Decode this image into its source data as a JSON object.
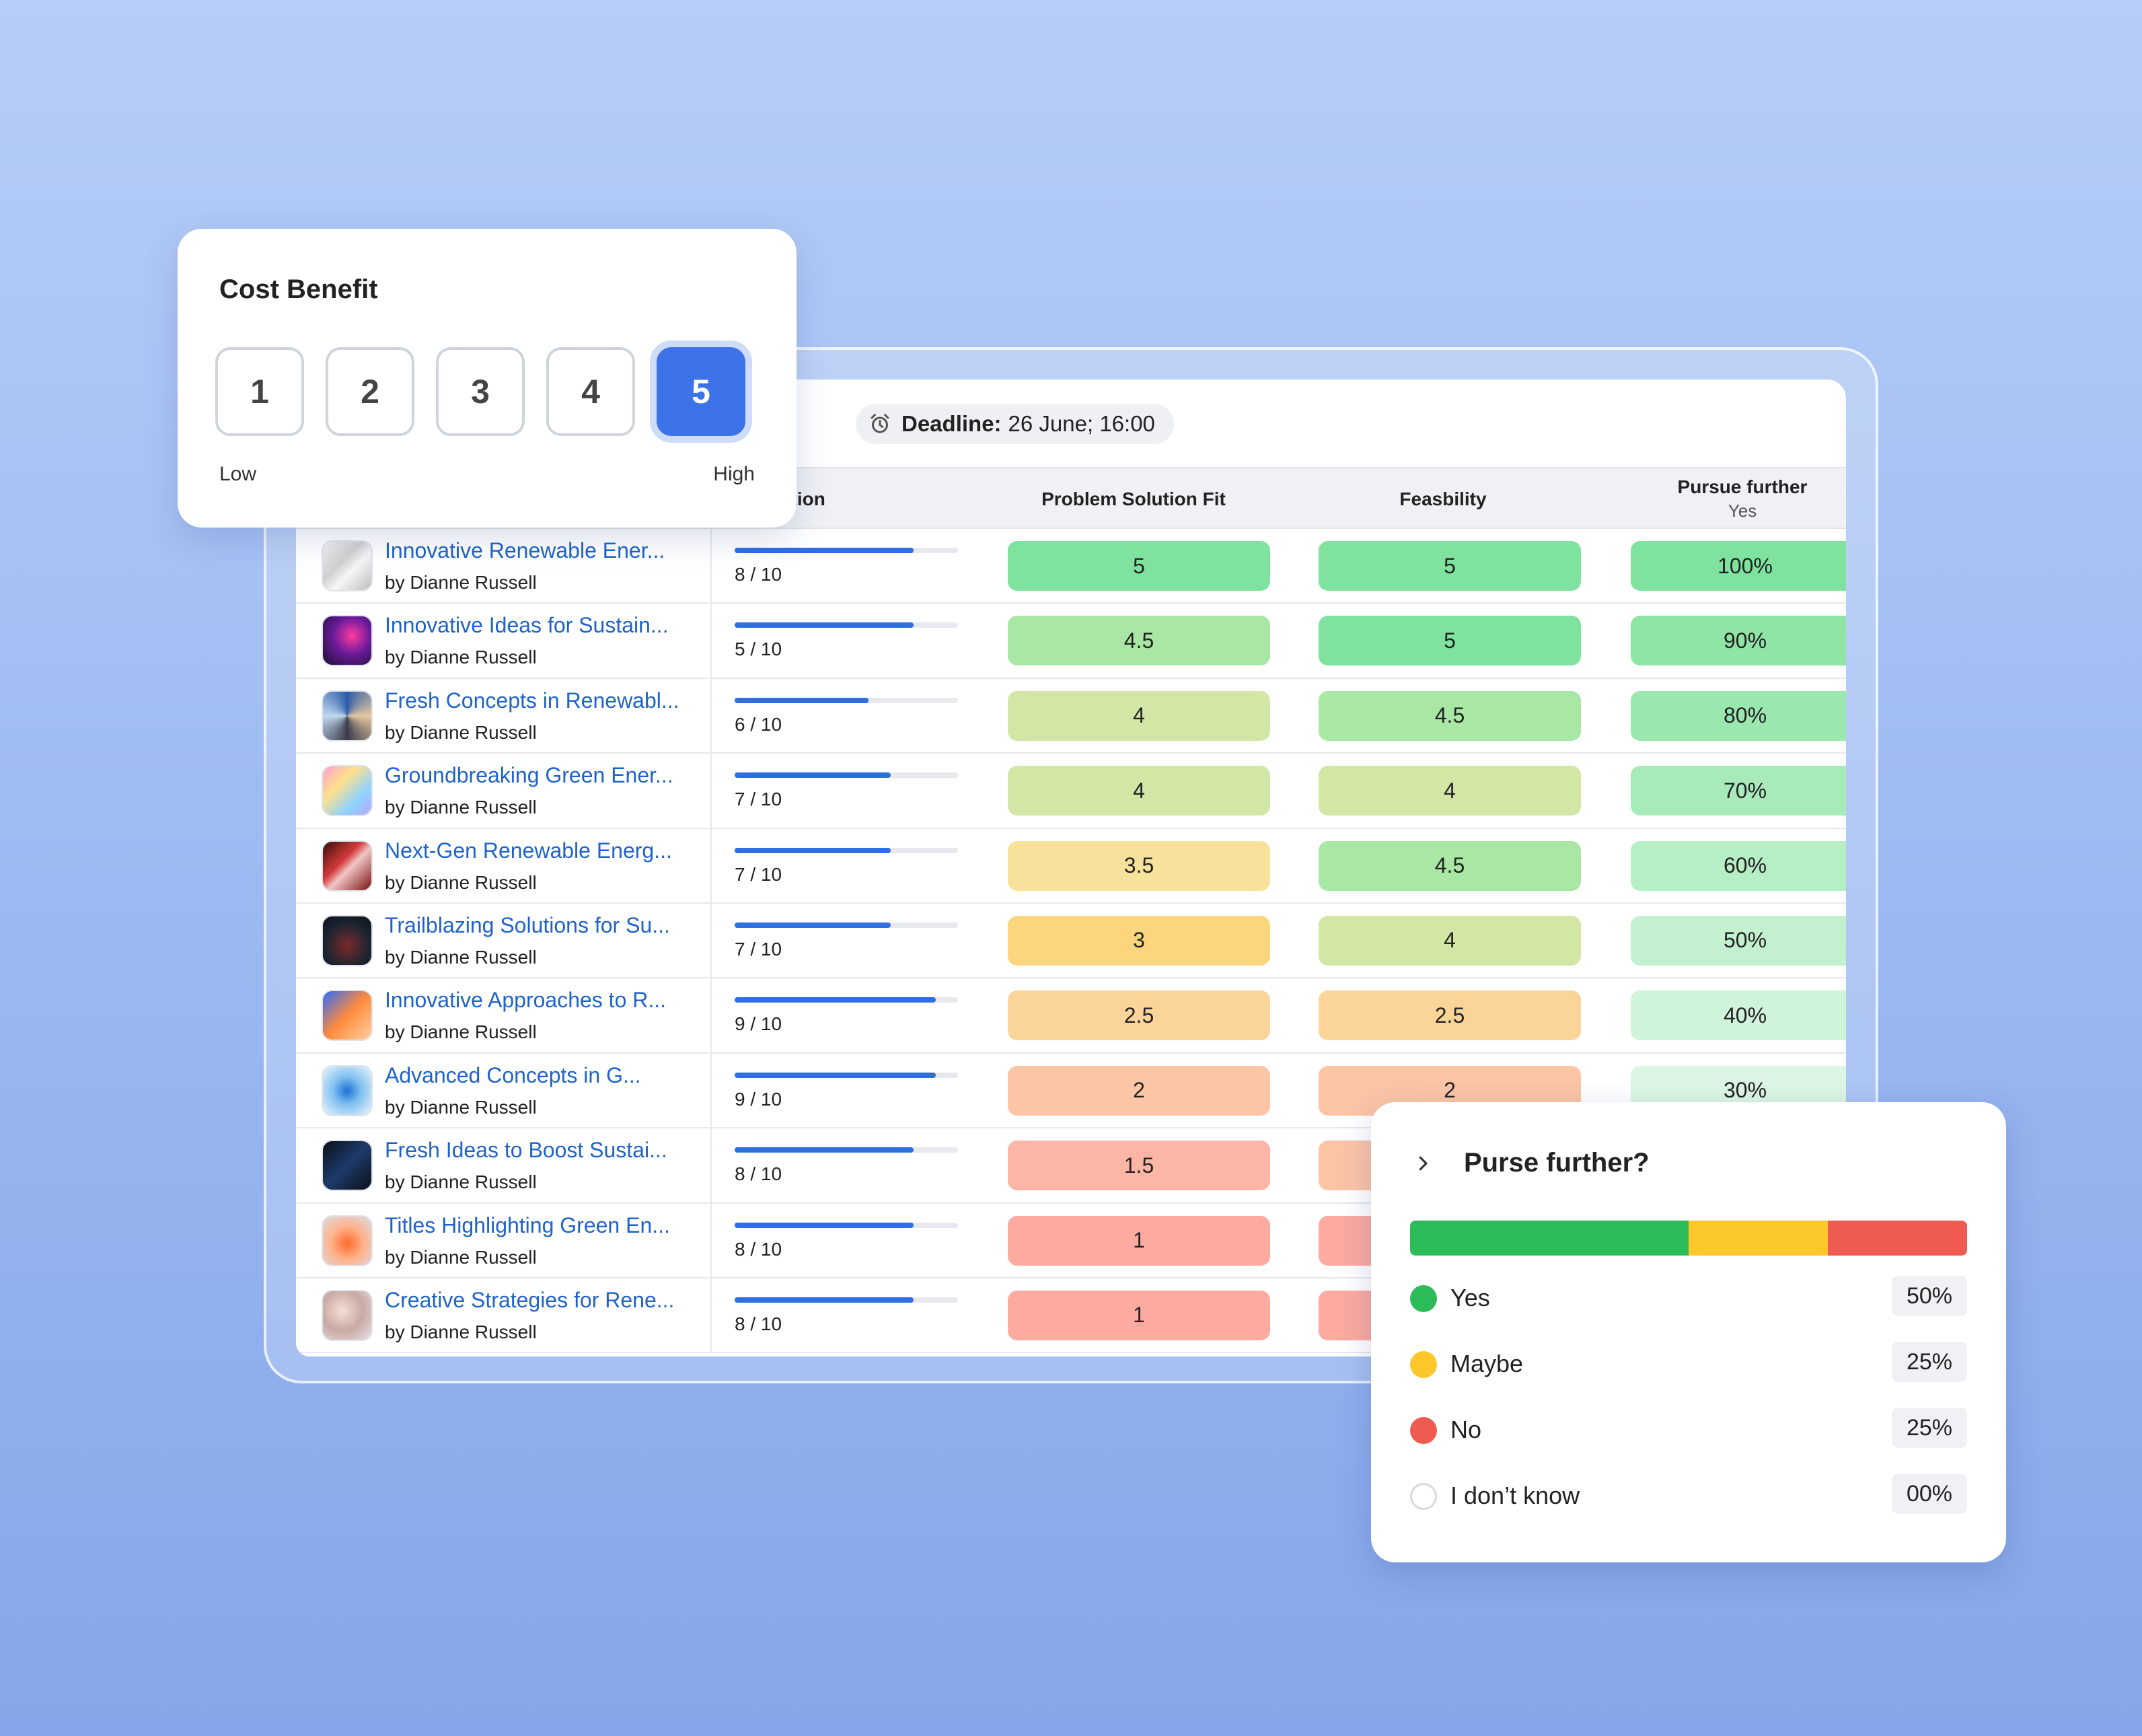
{
  "toolbar": {
    "percent_fragment": "%",
    "deadline_label": "Deadline:",
    "deadline_value": "26 June; 16:00"
  },
  "table": {
    "columns": {
      "completion": "etion",
      "problem_solution_fit": "Problem Solution Fit",
      "feasibility": "Feasbility",
      "pursue_further": "Pursue further",
      "pursue_further_sub": "Yes"
    },
    "rows": [
      {
        "title": "Innovative Renewable Ener...",
        "author": "by Dianne Russell",
        "score": "8 / 10",
        "progress": 0.8,
        "psf": "5",
        "feas": "5",
        "pursue": "100%",
        "psf_color": "#7fe29e",
        "feas_color": "#7fe29e",
        "pursue_color": "#7fe29e"
      },
      {
        "title": "Innovative Ideas for Sustain...",
        "author": "by Dianne Russell",
        "score": "5 / 10",
        "progress": 0.8,
        "psf": "4.5",
        "feas": "5",
        "pursue": "90%",
        "psf_color": "#a9e7a4",
        "feas_color": "#7fe29e",
        "pursue_color": "#8ee5a6"
      },
      {
        "title": "Fresh Concepts in Renewabl...",
        "author": "by Dianne Russell",
        "score": "6 / 10",
        "progress": 0.6,
        "psf": "4",
        "feas": "4.5",
        "pursue": "80%",
        "psf_color": "#d2e6a6",
        "feas_color": "#a9e7a4",
        "pursue_color": "#9ae8b0"
      },
      {
        "title": "Groundbreaking Green Ener...",
        "author": "by Dianne Russell",
        "score": "7 / 10",
        "progress": 0.7,
        "psf": "4",
        "feas": "4",
        "pursue": "70%",
        "psf_color": "#d2e6a6",
        "feas_color": "#d2e6a6",
        "pursue_color": "#a8ebbb"
      },
      {
        "title": "Next-Gen Renewable Energ...",
        "author": "by Dianne Russell",
        "score": "7 / 10",
        "progress": 0.7,
        "psf": "3.5",
        "feas": "4.5",
        "pursue": "60%",
        "psf_color": "#f7e29c",
        "feas_color": "#a9e7a4",
        "pursue_color": "#b6eec5"
      },
      {
        "title": "Trailblazing Solutions for Su...",
        "author": "by Dianne Russell",
        "score": "7 / 10",
        "progress": 0.7,
        "psf": "3",
        "feas": "4",
        "pursue": "50%",
        "psf_color": "#fbd67e",
        "feas_color": "#d2e6a6",
        "pursue_color": "#c3f1cf"
      },
      {
        "title": "Innovative Approaches to R...",
        "author": "by Dianne Russell",
        "score": "9 / 10",
        "progress": 0.9,
        "psf": "2.5",
        "feas": "2.5",
        "pursue": "40%",
        "psf_color": "#fbd49a",
        "feas_color": "#fbd49a",
        "pursue_color": "#d0f4da"
      },
      {
        "title": "Advanced Concepts in G...",
        "author": "by Dianne Russell",
        "score": "9 / 10",
        "progress": 0.9,
        "psf": "2",
        "feas": "2",
        "pursue": "30%",
        "psf_color": "#fcc5a6",
        "feas_color": "#fcc5a6",
        "pursue_color": "#ddf6e4"
      },
      {
        "title": "Fresh Ideas to Boost Sustai...",
        "author": "by Dianne Russell",
        "score": "8 / 10",
        "progress": 0.8,
        "psf": "1.5",
        "feas": "",
        "pursue": "",
        "psf_color": "#fdb6a6",
        "feas_color": "#fcc5a6",
        "pursue_color": "#e6f8ea"
      },
      {
        "title": "Titles Highlighting Green En...",
        "author": "by Dianne Russell",
        "score": "8 / 10",
        "progress": 0.8,
        "psf": "1",
        "feas": "",
        "pursue": "",
        "psf_color": "#fdaaa0",
        "feas_color": "#fdaaa0",
        "pursue_color": "#eefaf1"
      },
      {
        "title": "Creative Strategies for Rene...",
        "author": "by Dianne Russell",
        "score": "8 / 10",
        "progress": 0.8,
        "psf": "1",
        "feas": "",
        "pursue": "",
        "psf_color": "#fdaaa0",
        "feas_color": "#fdaaa0",
        "pursue_color": "#f2fbf4"
      }
    ]
  },
  "cost_benefit": {
    "title": "Cost Benefit",
    "options": [
      "1",
      "2",
      "3",
      "4",
      "5"
    ],
    "selected": "5",
    "low_label": "Low",
    "high_label": "High"
  },
  "purse_further": {
    "title": "Purse further?",
    "segments": [
      {
        "label": "Yes",
        "value": 0.5,
        "color": "#2cbb59"
      },
      {
        "label": "Maybe",
        "value": 0.25,
        "color": "#fcc72b"
      },
      {
        "label": "No",
        "value": 0.25,
        "color": "#ef5b50"
      }
    ],
    "items": [
      {
        "label": "Yes",
        "value": "50%",
        "color": "#2cbb59"
      },
      {
        "label": "Maybe",
        "value": "25%",
        "color": "#fcc72b"
      },
      {
        "label": "No",
        "value": "25%",
        "color": "#ef5b50"
      },
      {
        "label": "I don’t know",
        "value": "00%",
        "color": ""
      }
    ]
  },
  "icons": {
    "alarm": "alarm-clock-icon",
    "chevron": "chevron-right-icon"
  }
}
